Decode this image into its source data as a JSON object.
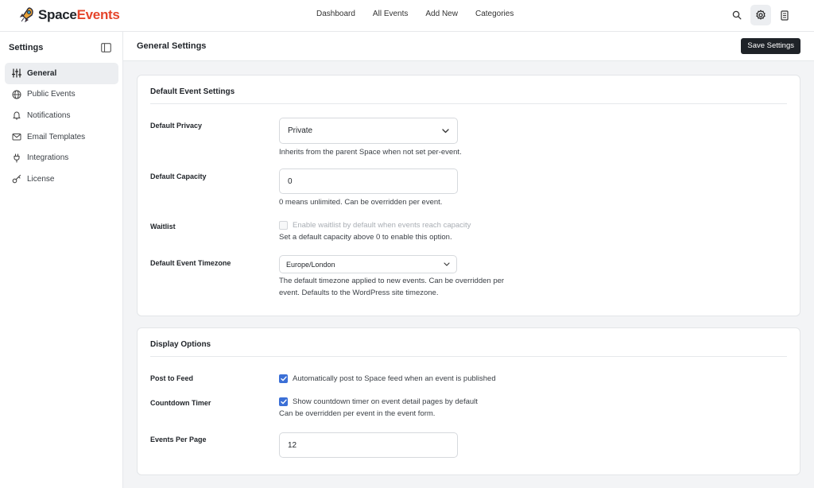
{
  "app": {
    "logo_primary": "Space",
    "logo_accent": "Events",
    "accent_color": "#e5452b"
  },
  "topnav": {
    "items": [
      "Dashboard",
      "All Events",
      "Add New",
      "Categories"
    ]
  },
  "top_icons": [
    "search-icon",
    "gear-icon",
    "document-icon"
  ],
  "sidebar": {
    "title": "Settings",
    "items": [
      {
        "label": "General",
        "icon": "sliders-icon",
        "active": true
      },
      {
        "label": "Public Events",
        "icon": "globe-icon"
      },
      {
        "label": "Notifications",
        "icon": "bell-icon"
      },
      {
        "label": "Email Templates",
        "icon": "mail-icon"
      },
      {
        "label": "Integrations",
        "icon": "plug-icon"
      },
      {
        "label": "License",
        "icon": "key-icon"
      }
    ]
  },
  "header": {
    "title": "General Settings",
    "save_label": "Save Settings"
  },
  "default_event": {
    "title": "Default Event Settings",
    "privacy": {
      "label": "Default Privacy",
      "value": "Private",
      "help": "Inherits from the parent Space when not set per-event."
    },
    "capacity": {
      "label": "Default Capacity",
      "value": "0",
      "help": "0 means unlimited. Can be overridden per event."
    },
    "waitlist": {
      "label": "Waitlist",
      "checkbox_label": "Enable waitlist by default when events reach capacity",
      "checked": false,
      "disabled": true,
      "help": "Set a default capacity above 0 to enable this option."
    },
    "timezone": {
      "label": "Default Event Timezone",
      "value": "Europe/London",
      "help_line1": "The default timezone applied to new events. Can be overridden per",
      "help_line2": "event. Defaults to the WordPress site timezone."
    }
  },
  "display": {
    "title": "Display Options",
    "post_to_feed": {
      "label": "Post to Feed",
      "checkbox_label": "Automatically post to Space feed when an event is published",
      "checked": true
    },
    "countdown": {
      "label": "Countdown Timer",
      "checkbox_label": "Show countdown timer on event detail pages by default",
      "checked": true,
      "help": "Can be overridden per event in the event form."
    },
    "per_page": {
      "label": "Events Per Page",
      "value": "12"
    }
  }
}
